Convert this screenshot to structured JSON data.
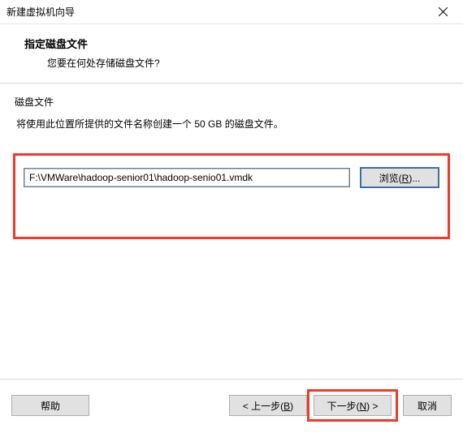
{
  "window": {
    "title": "新建虚拟机向导"
  },
  "header": {
    "title": "指定磁盘文件",
    "subtitle": "您要在何处存储磁盘文件?"
  },
  "group": {
    "label": "磁盘文件",
    "description": "将使用此位置所提供的文件名称创建一个 50 GB 的磁盘文件。"
  },
  "path": {
    "value": "F:\\VMWare\\hadoop-senior01\\hadoop-senio01.vmdk"
  },
  "buttons": {
    "browse_pre": "浏览(",
    "browse_key": "R",
    "browse_post": ")...",
    "help": "帮助",
    "back_pre": "< 上一步(",
    "back_key": "B",
    "back_post": ")",
    "next_pre": "下一步(",
    "next_key": "N",
    "next_post": ") >",
    "cancel": "取消"
  }
}
